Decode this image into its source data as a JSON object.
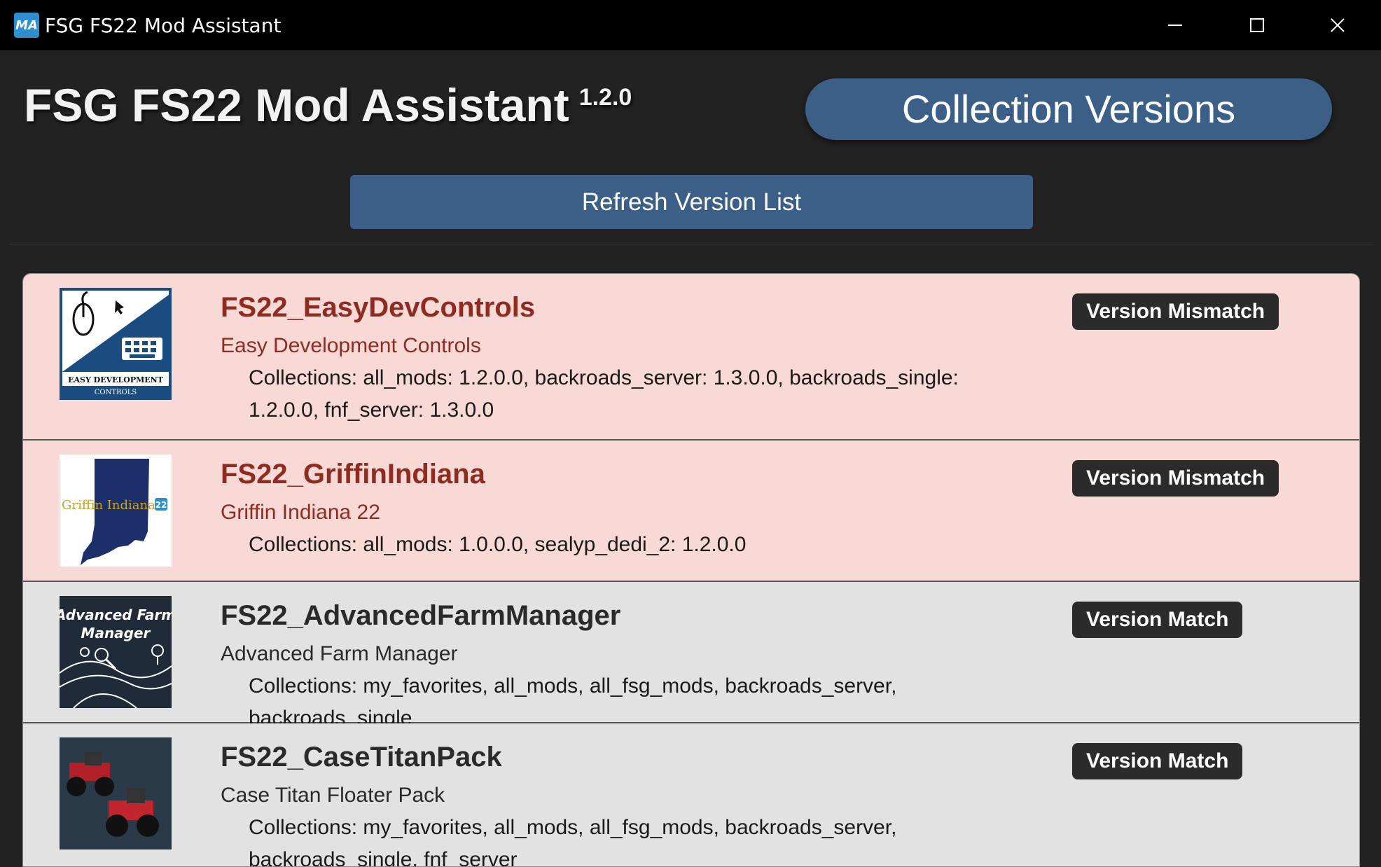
{
  "window": {
    "title": "FSG FS22 Mod Assistant",
    "icon_text": "MA"
  },
  "header": {
    "app_name": "FSG FS22 Mod Assistant",
    "version": "1.2.0",
    "page_title": "Collection Versions"
  },
  "toolbar": {
    "refresh_label": "Refresh Version List"
  },
  "colors": {
    "mismatch_bg": "#f9d9d6",
    "match_bg": "#e2e2e2",
    "accent": "#3b5f86"
  },
  "mods": [
    {
      "name": "FS22_EasyDevControls",
      "title": "Easy Development Controls",
      "collections": "Collections: all_mods: 1.2.0.0, backroads_server: 1.3.0.0, backroads_single: 1.2.0.0, fnf_server: 1.3.0.0",
      "status": "Version Mismatch",
      "icon_text_1": "EASY DEVELOPMENT",
      "icon_text_2": "CONTROLS"
    },
    {
      "name": "FS22_GriffinIndiana",
      "title": "Griffin Indiana 22",
      "collections": "Collections: all_mods: 1.0.0.0, sealyp_dedi_2: 1.2.0.0",
      "status": "Version Mismatch",
      "icon_text_1": "Griffin Indiana",
      "icon_text_2": "22"
    },
    {
      "name": "FS22_AdvancedFarmManager",
      "title": "Advanced Farm Manager",
      "collections": "Collections: my_favorites, all_mods, all_fsg_mods, backroads_server, backroads_single",
      "status": "Version Match",
      "icon_text_1": "Advanced Farm",
      "icon_text_2": "Manager"
    },
    {
      "name": "FS22_CaseTitanPack",
      "title": "Case Titan Floater Pack",
      "collections": "Collections: my_favorites, all_mods, all_fsg_mods, backroads_server, backroads_single, fnf_server",
      "status": "Version Match"
    }
  ]
}
